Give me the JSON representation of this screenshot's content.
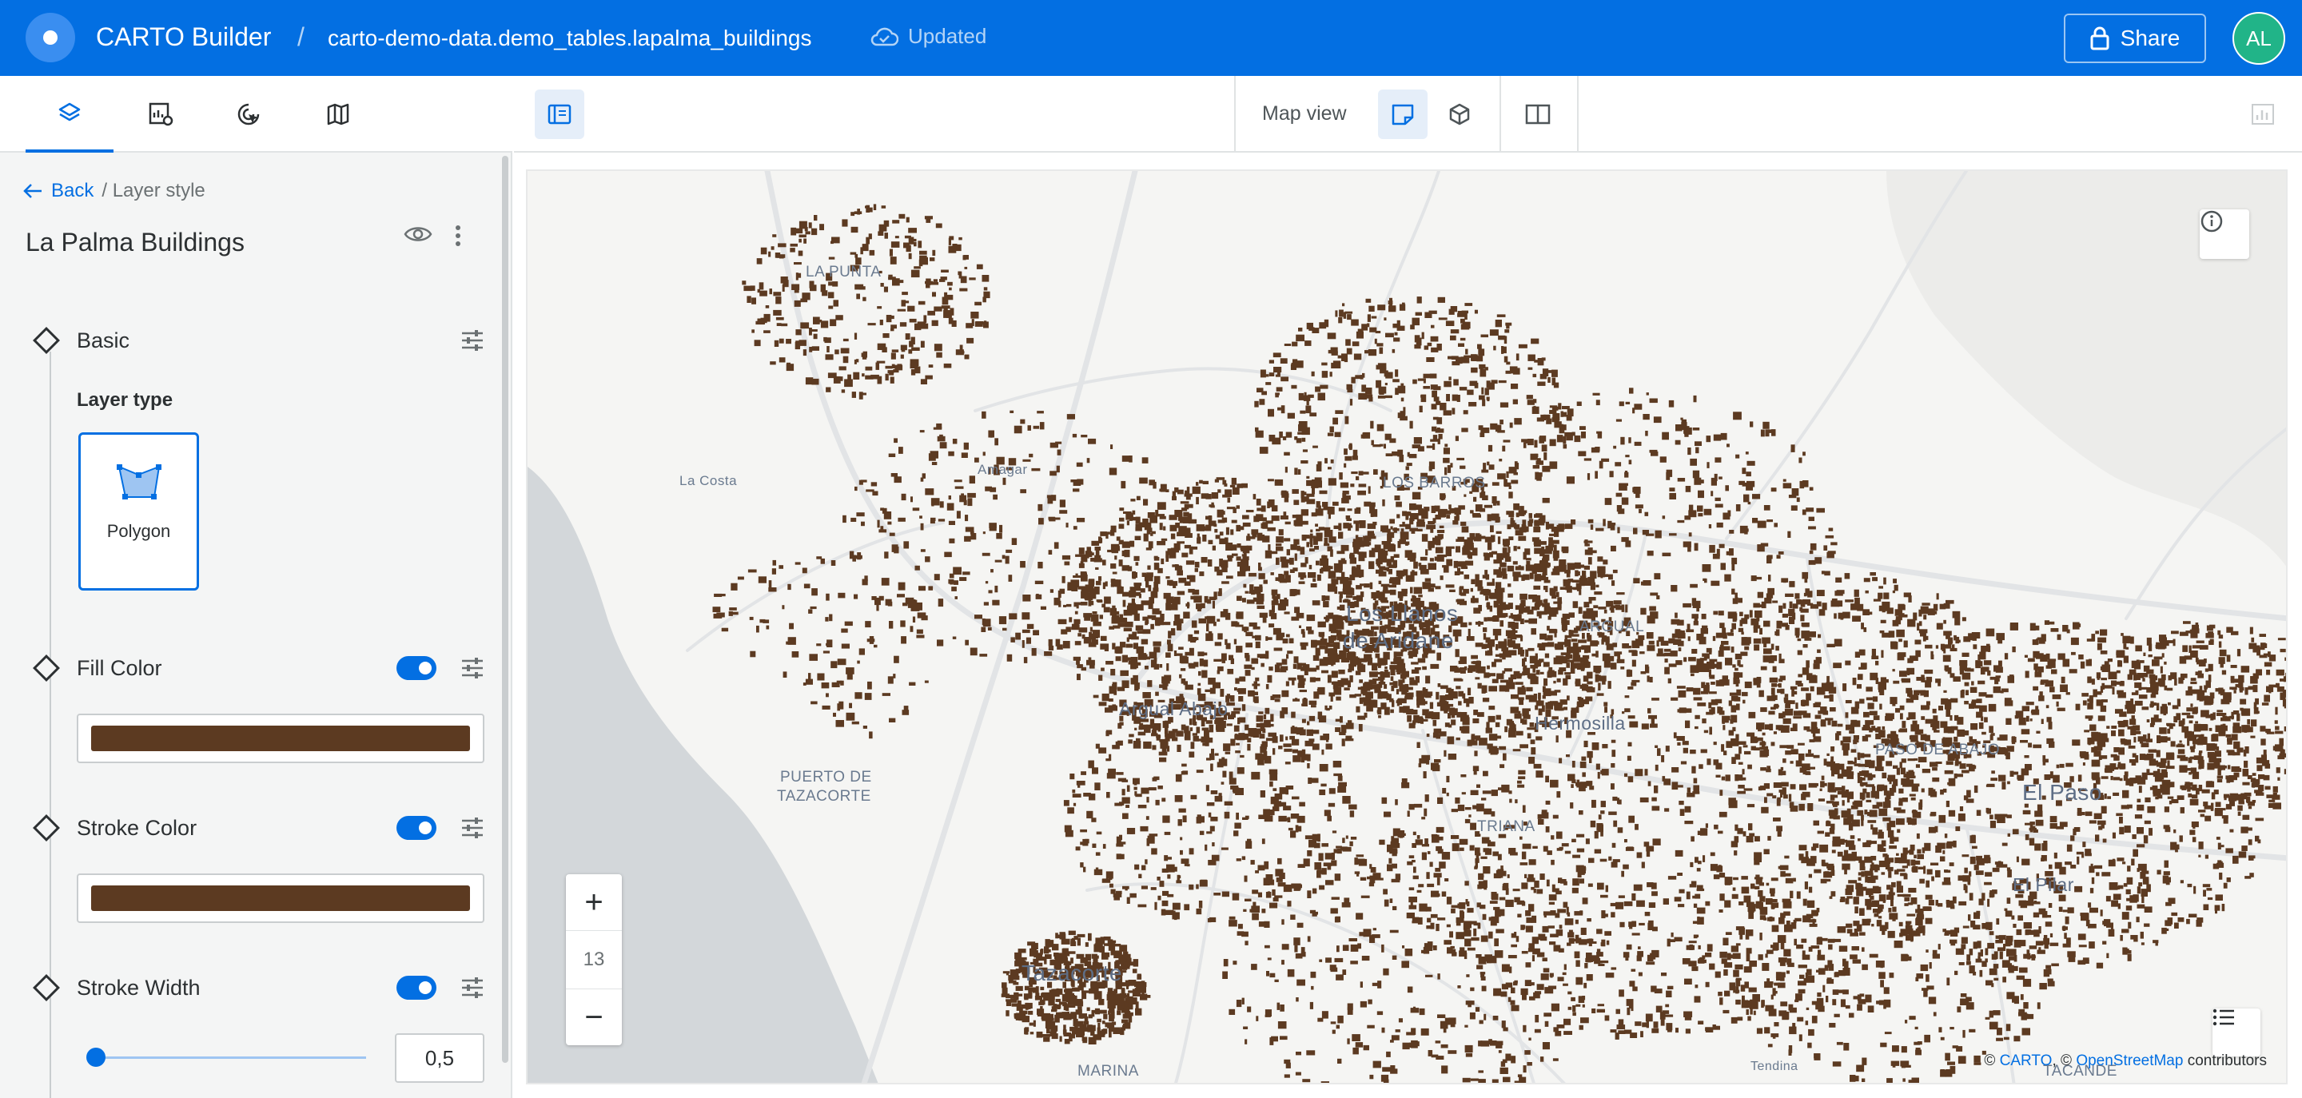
{
  "header": {
    "app_title": "CARTO Builder",
    "separator": "/",
    "dataset": "carto-demo-data.demo_tables.lapalma_buildings",
    "status": "Updated",
    "share_label": "Share",
    "avatar_initials": "AL",
    "brand_color": "#036fe2"
  },
  "sidebar": {
    "tabs": [
      {
        "name": "layers-tab",
        "icon": "layers-icon",
        "active": true
      },
      {
        "name": "widgets-tab",
        "icon": "widgets-icon",
        "active": false
      },
      {
        "name": "interactions-tab",
        "icon": "interactions-icon",
        "active": false
      },
      {
        "name": "basemaps-tab",
        "icon": "map-icon",
        "active": false
      }
    ],
    "back_label": "Back",
    "breadcrumb_path": "/ Layer style",
    "layer_title": "La Palma Buildings",
    "sections": {
      "basic": {
        "label": "Basic",
        "layer_type_label": "Layer type",
        "layer_type": "Polygon"
      },
      "fill_color": {
        "label": "Fill Color",
        "enabled": true,
        "color": "#5c3a21"
      },
      "stroke_color": {
        "label": "Stroke Color",
        "enabled": true,
        "color": "#5c3a21"
      },
      "stroke_width": {
        "label": "Stroke Width",
        "enabled": true,
        "value": "0,5",
        "slider_fraction": 0.03
      }
    }
  },
  "map_toolbar": {
    "map_view_label": "Map view"
  },
  "map": {
    "zoom_in": "+",
    "zoom_level": "13",
    "zoom_out": "−",
    "labels": [
      {
        "text": "LA PUNTA",
        "size": "small"
      },
      {
        "text": "La Costa",
        "size": "small"
      },
      {
        "text": "Amagar",
        "size": "small"
      },
      {
        "text": "LOS BARROS",
        "size": "small"
      },
      {
        "text": "Los Llanos",
        "size": "big"
      },
      {
        "text": "de Aridane",
        "size": "big"
      },
      {
        "text": "ARGUAL",
        "size": "small"
      },
      {
        "text": "Argual Abajo",
        "size": "mid"
      },
      {
        "text": "Hermosilla",
        "size": "mid"
      },
      {
        "text": "PUERTO DE",
        "size": "small"
      },
      {
        "text": "TAZACORTE",
        "size": "small"
      },
      {
        "text": "TRIANA",
        "size": "small"
      },
      {
        "text": "PASO DE ABAJO",
        "size": "small"
      },
      {
        "text": "El Paso",
        "size": "big"
      },
      {
        "text": "El Pilar",
        "size": "mid"
      },
      {
        "text": "Tazacorte",
        "size": "big"
      },
      {
        "text": "MARINA",
        "size": "small"
      },
      {
        "text": "Tendina",
        "size": "small"
      },
      {
        "text": "TACANDE",
        "size": "small"
      }
    ],
    "attribution_prefix": "© ",
    "attribution_carto": "CARTO",
    "attribution_mid": ", © ",
    "attribution_osm": "OpenStreetMap",
    "attribution_suffix": " contributors",
    "building_color": "#5c3a21",
    "sea_color": "#d3d7da",
    "land_color": "#f5f5f3",
    "road_color": "#e2e4e6"
  }
}
